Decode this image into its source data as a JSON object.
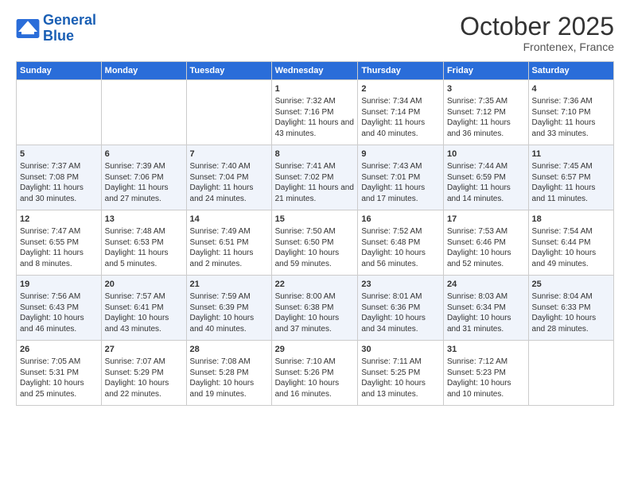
{
  "logo": {
    "line1": "General",
    "line2": "Blue"
  },
  "title": "October 2025",
  "location": "Frontenex, France",
  "days_of_week": [
    "Sunday",
    "Monday",
    "Tuesday",
    "Wednesday",
    "Thursday",
    "Friday",
    "Saturday"
  ],
  "weeks": [
    [
      {
        "day": "",
        "info": ""
      },
      {
        "day": "",
        "info": ""
      },
      {
        "day": "",
        "info": ""
      },
      {
        "day": "1",
        "info": "Sunrise: 7:32 AM\nSunset: 7:16 PM\nDaylight: 11 hours and 43 minutes."
      },
      {
        "day": "2",
        "info": "Sunrise: 7:34 AM\nSunset: 7:14 PM\nDaylight: 11 hours and 40 minutes."
      },
      {
        "day": "3",
        "info": "Sunrise: 7:35 AM\nSunset: 7:12 PM\nDaylight: 11 hours and 36 minutes."
      },
      {
        "day": "4",
        "info": "Sunrise: 7:36 AM\nSunset: 7:10 PM\nDaylight: 11 hours and 33 minutes."
      }
    ],
    [
      {
        "day": "5",
        "info": "Sunrise: 7:37 AM\nSunset: 7:08 PM\nDaylight: 11 hours and 30 minutes."
      },
      {
        "day": "6",
        "info": "Sunrise: 7:39 AM\nSunset: 7:06 PM\nDaylight: 11 hours and 27 minutes."
      },
      {
        "day": "7",
        "info": "Sunrise: 7:40 AM\nSunset: 7:04 PM\nDaylight: 11 hours and 24 minutes."
      },
      {
        "day": "8",
        "info": "Sunrise: 7:41 AM\nSunset: 7:02 PM\nDaylight: 11 hours and 21 minutes."
      },
      {
        "day": "9",
        "info": "Sunrise: 7:43 AM\nSunset: 7:01 PM\nDaylight: 11 hours and 17 minutes."
      },
      {
        "day": "10",
        "info": "Sunrise: 7:44 AM\nSunset: 6:59 PM\nDaylight: 11 hours and 14 minutes."
      },
      {
        "day": "11",
        "info": "Sunrise: 7:45 AM\nSunset: 6:57 PM\nDaylight: 11 hours and 11 minutes."
      }
    ],
    [
      {
        "day": "12",
        "info": "Sunrise: 7:47 AM\nSunset: 6:55 PM\nDaylight: 11 hours and 8 minutes."
      },
      {
        "day": "13",
        "info": "Sunrise: 7:48 AM\nSunset: 6:53 PM\nDaylight: 11 hours and 5 minutes."
      },
      {
        "day": "14",
        "info": "Sunrise: 7:49 AM\nSunset: 6:51 PM\nDaylight: 11 hours and 2 minutes."
      },
      {
        "day": "15",
        "info": "Sunrise: 7:50 AM\nSunset: 6:50 PM\nDaylight: 10 hours and 59 minutes."
      },
      {
        "day": "16",
        "info": "Sunrise: 7:52 AM\nSunset: 6:48 PM\nDaylight: 10 hours and 56 minutes."
      },
      {
        "day": "17",
        "info": "Sunrise: 7:53 AM\nSunset: 6:46 PM\nDaylight: 10 hours and 52 minutes."
      },
      {
        "day": "18",
        "info": "Sunrise: 7:54 AM\nSunset: 6:44 PM\nDaylight: 10 hours and 49 minutes."
      }
    ],
    [
      {
        "day": "19",
        "info": "Sunrise: 7:56 AM\nSunset: 6:43 PM\nDaylight: 10 hours and 46 minutes."
      },
      {
        "day": "20",
        "info": "Sunrise: 7:57 AM\nSunset: 6:41 PM\nDaylight: 10 hours and 43 minutes."
      },
      {
        "day": "21",
        "info": "Sunrise: 7:59 AM\nSunset: 6:39 PM\nDaylight: 10 hours and 40 minutes."
      },
      {
        "day": "22",
        "info": "Sunrise: 8:00 AM\nSunset: 6:38 PM\nDaylight: 10 hours and 37 minutes."
      },
      {
        "day": "23",
        "info": "Sunrise: 8:01 AM\nSunset: 6:36 PM\nDaylight: 10 hours and 34 minutes."
      },
      {
        "day": "24",
        "info": "Sunrise: 8:03 AM\nSunset: 6:34 PM\nDaylight: 10 hours and 31 minutes."
      },
      {
        "day": "25",
        "info": "Sunrise: 8:04 AM\nSunset: 6:33 PM\nDaylight: 10 hours and 28 minutes."
      }
    ],
    [
      {
        "day": "26",
        "info": "Sunrise: 7:05 AM\nSunset: 5:31 PM\nDaylight: 10 hours and 25 minutes."
      },
      {
        "day": "27",
        "info": "Sunrise: 7:07 AM\nSunset: 5:29 PM\nDaylight: 10 hours and 22 minutes."
      },
      {
        "day": "28",
        "info": "Sunrise: 7:08 AM\nSunset: 5:28 PM\nDaylight: 10 hours and 19 minutes."
      },
      {
        "day": "29",
        "info": "Sunrise: 7:10 AM\nSunset: 5:26 PM\nDaylight: 10 hours and 16 minutes."
      },
      {
        "day": "30",
        "info": "Sunrise: 7:11 AM\nSunset: 5:25 PM\nDaylight: 10 hours and 13 minutes."
      },
      {
        "day": "31",
        "info": "Sunrise: 7:12 AM\nSunset: 5:23 PM\nDaylight: 10 hours and 10 minutes."
      },
      {
        "day": "",
        "info": ""
      }
    ]
  ]
}
